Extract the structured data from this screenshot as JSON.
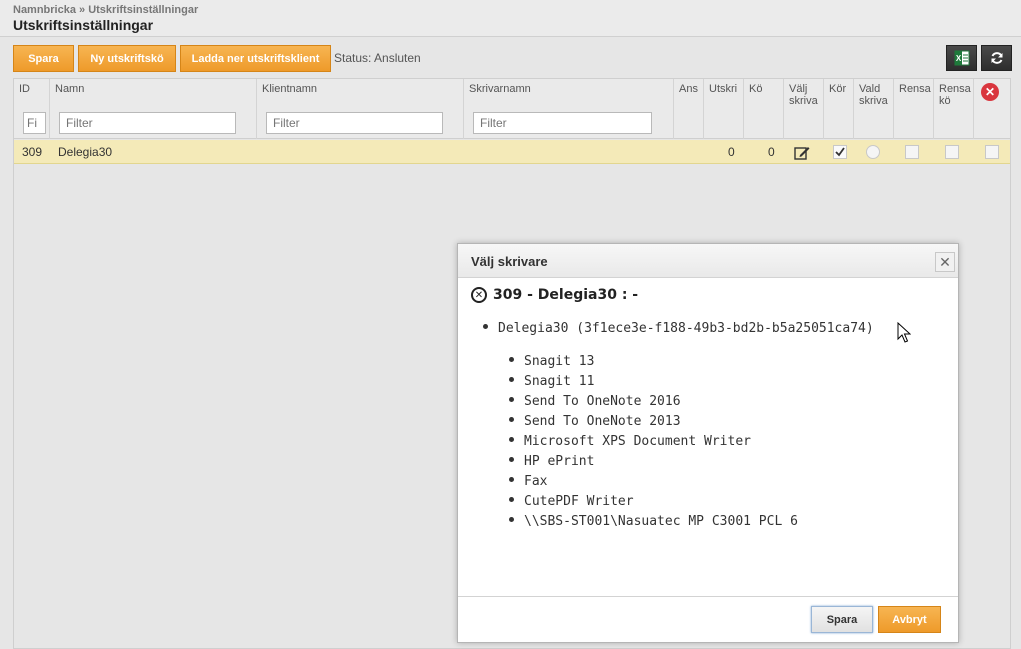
{
  "header": {
    "breadcrumb": "Namnbricka » Utskriftsinställningar",
    "title": "Utskriftsinställningar"
  },
  "toolbar": {
    "save_label": "Spara",
    "new_queue_label": "Ny utskriftskö",
    "download_client_label": "Ladda ner utskriftsklient",
    "status_text": "Status: Ansluten",
    "excel_icon": "excel-export-icon",
    "refresh_icon": "refresh-icon"
  },
  "grid": {
    "columns": {
      "id": "ID",
      "name": "Namn",
      "client_name": "Klientnamn",
      "printer_name": "Skrivarnamn",
      "ans": "Ans",
      "utskri": "Utskri",
      "queue": "Kö",
      "choose_printer_1": "Välj",
      "choose_printer_2": "skriva",
      "running": "Kör",
      "chosen_printer_1": "Vald",
      "chosen_printer_2": "skriva",
      "clean_1": "Rensa",
      "clean_2": "Rensa",
      "clean_2b": "kö"
    },
    "filters": {
      "id_placeholder": "Fi",
      "name_placeholder": "Filter",
      "client_placeholder": "Filter",
      "printer_placeholder": "Filter"
    },
    "rows": [
      {
        "id": "309",
        "name": "Delegia30",
        "client_name": "",
        "printer_name": "",
        "utskri": "0",
        "queue": "0",
        "running": true
      }
    ]
  },
  "dialog": {
    "title": "Välj skrivare",
    "subtitle": "309 - Delegia30 : -",
    "client": "Delegia30 (3f1ece3e-f188-49b3-bd2b-b5a25051ca74)",
    "printers": [
      "Snagit 13",
      "Snagit 11",
      "Send To OneNote 2016",
      "Send To OneNote 2013",
      "Microsoft XPS Document Writer",
      "HP ePrint",
      "Fax",
      "CutePDF Writer",
      "\\\\SBS-ST001\\Nasuatec MP C3001 PCL 6"
    ],
    "save_label": "Spara",
    "cancel_label": "Avbryt"
  },
  "colors": {
    "accent": "#ee9a2a",
    "row_highlight": "#f4eab8",
    "remove_red": "#d9363e"
  }
}
